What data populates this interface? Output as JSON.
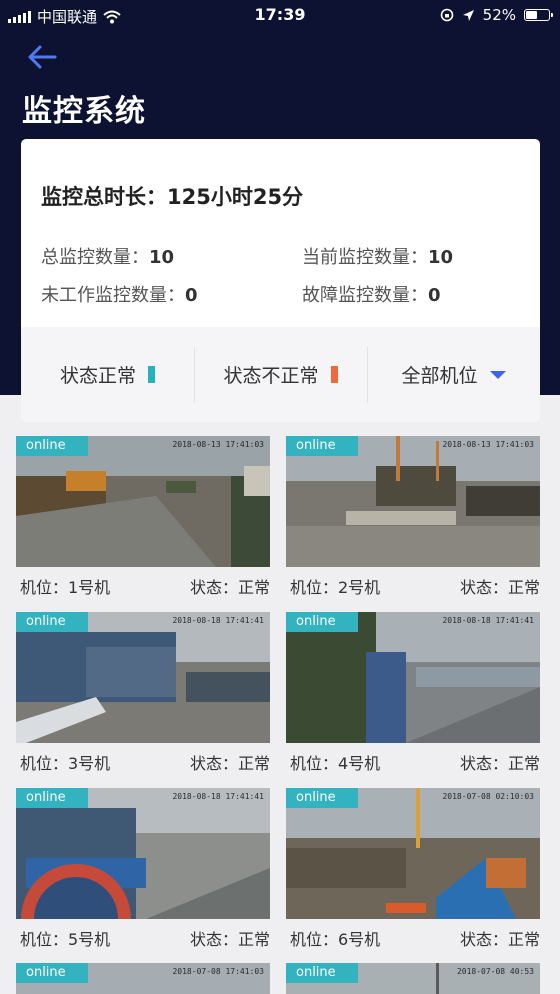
{
  "status_bar": {
    "carrier": "中国联通",
    "time": "17:39",
    "battery": "52%"
  },
  "header": {
    "title": "监控系统"
  },
  "summary": {
    "total_duration_label": "监控总时长：",
    "total_duration_value": "125小时25分",
    "total_count_label": "总监控数量：",
    "total_count_value": "10",
    "current_count_label": "当前监控数量：",
    "current_count_value": "10",
    "idle_count_label": "未工作监控数量：",
    "idle_count_value": "0",
    "fault_count_label": "故障监控数量：",
    "fault_count_value": "0"
  },
  "filters": {
    "normal_label": "状态正常",
    "abnormal_label": "状态不正常",
    "position_label": "全部机位"
  },
  "colors": {
    "normal": "#27b1c0",
    "abnormal": "#ee6a3c",
    "online_tag": "#33b3c0",
    "header_bg": "#0d1132",
    "caret": "#3f63e4"
  },
  "cameras": [
    {
      "tag": "online",
      "timestamp": "2018-08-13 17:41:03",
      "position": "机位：1号机",
      "status": "状态：正常"
    },
    {
      "tag": "online",
      "timestamp": "2018-08-13 17:41:03",
      "position": "机位：2号机",
      "status": "状态：正常"
    },
    {
      "tag": "online",
      "timestamp": "2018-08-18 17:41:41",
      "position": "机位：3号机",
      "status": "状态：正常"
    },
    {
      "tag": "online",
      "timestamp": "2018-08-18 17:41:41",
      "position": "机位：4号机",
      "status": "状态：正常"
    },
    {
      "tag": "online",
      "timestamp": "2018-08-18 17:41:41",
      "position": "机位：5号机",
      "status": "状态：正常"
    },
    {
      "tag": "online",
      "timestamp": "2018-07-08 02:10:03",
      "position": "机位：6号机",
      "status": "状态：正常"
    },
    {
      "tag": "online",
      "timestamp": "2018-07-08 17:41:03",
      "position": "",
      "status": ""
    },
    {
      "tag": "online",
      "timestamp": "2018-07-08 40:53",
      "position": "",
      "status": ""
    }
  ]
}
